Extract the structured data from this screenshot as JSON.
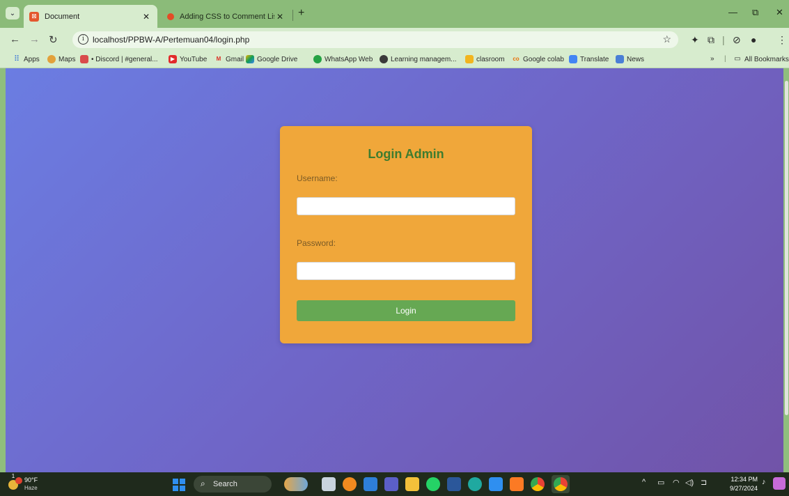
{
  "browser": {
    "tabs": [
      {
        "title": "Document",
        "active": true,
        "icon": "xampp-icon"
      },
      {
        "title": "Adding CSS to Comment List -",
        "active": false,
        "icon": "css-icon"
      }
    ],
    "url": "localhost/PPBW-A/Pertemuan04/login.php",
    "bookmarks": [
      {
        "label": "Apps",
        "icon": "apps-grid-icon"
      },
      {
        "label": "Maps",
        "icon": "maps-icon"
      },
      {
        "label": "• Discord | #general...",
        "icon": "discord-icon"
      },
      {
        "label": "YouTube",
        "icon": "youtube-icon"
      },
      {
        "label": "Gmail",
        "icon": "gmail-icon"
      },
      {
        "label": "Google Drive",
        "icon": "drive-icon"
      },
      {
        "label": "WhatsApp Web",
        "icon": "whatsapp-icon"
      },
      {
        "label": "Learning managem...",
        "icon": "lms-icon"
      },
      {
        "label": "clasroom",
        "icon": "classroom-icon"
      },
      {
        "label": "Google colab",
        "icon": "colab-icon"
      },
      {
        "label": "Translate",
        "icon": "translate-icon"
      },
      {
        "label": "News",
        "icon": "news-icon"
      }
    ],
    "bookmarks_overflow": "»",
    "all_bookmarks": "All Bookmarks"
  },
  "login": {
    "title": "Login Admin",
    "username_label": "Username:",
    "username_value": "",
    "password_label": "Password:",
    "password_value": "",
    "submit_label": "Login"
  },
  "colors": {
    "card": "#f0a73a",
    "title": "#3e7c2f",
    "button": "#66a853",
    "gradient_start": "#6b7de2",
    "gradient_end": "#7153a8"
  },
  "taskbar": {
    "weather_temp": "90°F",
    "weather_condition": "Haze",
    "weather_badge": "1",
    "search_label": "Search",
    "time": "12:34 PM",
    "date": "9/27/2024"
  }
}
